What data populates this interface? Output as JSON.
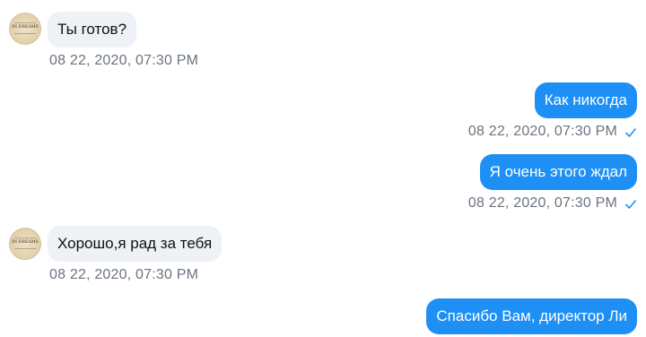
{
  "avatar": {
    "text": "IN DREAMS"
  },
  "messages": [
    {
      "direction": "in",
      "text": "Ты готов?",
      "time": "08 22, 2020, 07:30 PM"
    },
    {
      "direction": "out",
      "text": "Как никогда",
      "time": "08 22, 2020, 07:30 PM"
    },
    {
      "direction": "out",
      "text": "Я очень этого ждал",
      "time": "08 22, 2020, 07:30 PM"
    },
    {
      "direction": "in",
      "text": "Хорошо,я рад за тебя",
      "time": "08 22, 2020, 07:30 PM"
    },
    {
      "direction": "out",
      "text": "Спасибо Вам, директор Ли",
      "time": ""
    }
  ],
  "colors": {
    "outgoing_bubble": "#1e90f5",
    "incoming_bubble": "#eef1f5",
    "timestamp": "#6b7480",
    "read_check": "#1e90f5"
  },
  "icons": {
    "read_receipt": "check-icon"
  }
}
